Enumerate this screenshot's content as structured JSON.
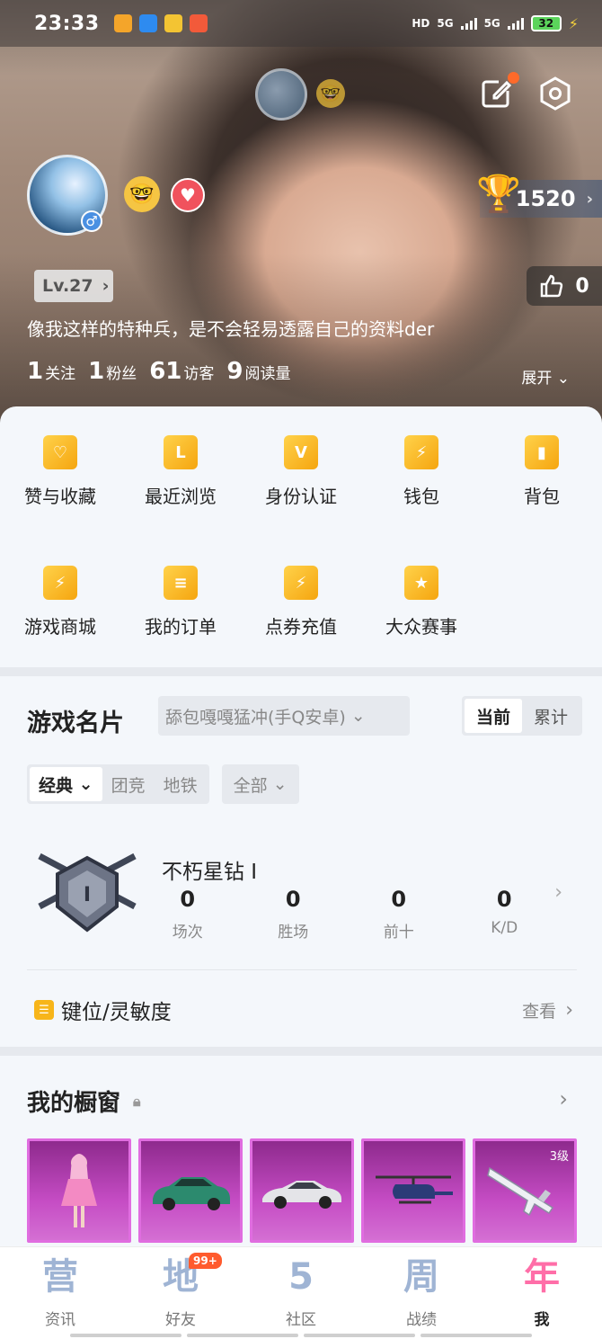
{
  "status_bar": {
    "time": "23:33",
    "network": [
      "HD",
      "5G",
      "5G"
    ],
    "battery": "32"
  },
  "profile": {
    "score": "1520",
    "level": "Lv.27",
    "likes": "0",
    "bio": "像我这样的特种兵，是不会轻易透露自己的资料der",
    "stats": [
      {
        "value": "1",
        "label": "关注"
      },
      {
        "value": "1",
        "label": "粉丝"
      },
      {
        "value": "61",
        "label": "访客"
      },
      {
        "value": "9",
        "label": "阅读量"
      }
    ],
    "expand_label": "展开"
  },
  "menu": {
    "row1": [
      {
        "label": "赞与收藏",
        "icon": "heart-bookmark-icon"
      },
      {
        "label": "最近浏览",
        "icon": "recent-browse-icon"
      },
      {
        "label": "身份认证",
        "icon": "verified-v-icon"
      },
      {
        "label": "钱包",
        "icon": "wallet-icon"
      },
      {
        "label": "背包",
        "icon": "backpack-icon"
      }
    ],
    "row2": [
      {
        "label": "游戏商城",
        "icon": "shopping-bag-icon"
      },
      {
        "label": "我的订单",
        "icon": "order-list-icon"
      },
      {
        "label": "点券充值",
        "icon": "voucher-card-icon"
      },
      {
        "label": "大众赛事",
        "icon": "tournament-trophy-icon"
      }
    ]
  },
  "game_card": {
    "title": "游戏名片",
    "server_select": "舔包嘎嘎猛冲(手Q安卓)",
    "scope_tabs": [
      "当前",
      "累计"
    ],
    "mode_tabs": [
      "经典",
      "团竞",
      "地铁"
    ],
    "filter": "全部",
    "rank_name": "不朽星钻 I",
    "rank_stats": [
      {
        "value": "0",
        "label": "场次"
      },
      {
        "value": "0",
        "label": "胜场"
      },
      {
        "value": "0",
        "label": "前十"
      },
      {
        "value": "0",
        "label": "K/D"
      }
    ],
    "keys_label": "键位/灵敏度",
    "view_label": "查看"
  },
  "showcase": {
    "title": "我的橱窗",
    "items": [
      {
        "name": "pink-dress-character-icon",
        "level": ""
      },
      {
        "name": "green-suv-icon",
        "level": ""
      },
      {
        "name": "silver-sports-car-icon",
        "level": ""
      },
      {
        "name": "helicopter-icon",
        "level": ""
      },
      {
        "name": "rifle-icon",
        "level": "3级"
      }
    ]
  },
  "tabbar": {
    "tabs": [
      {
        "glyph": "营",
        "label": "资讯"
      },
      {
        "glyph": "地",
        "label": "好友",
        "badge": "99+"
      },
      {
        "glyph": "5",
        "label": "社区"
      },
      {
        "glyph": "周",
        "label": "战绩"
      },
      {
        "glyph": "年",
        "label": "我"
      }
    ]
  },
  "colors": {
    "accent": "#f7b51a",
    "badge": "#ff5b2e",
    "showcase": "#c54cc4"
  }
}
